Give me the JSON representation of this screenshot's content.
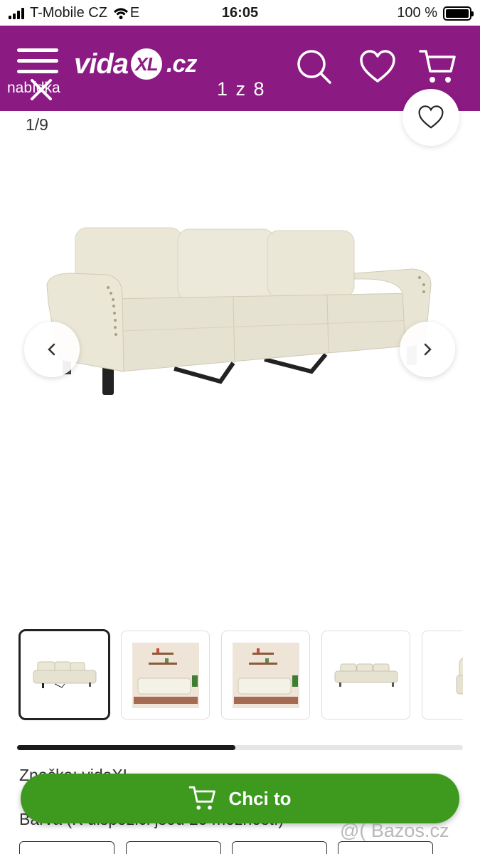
{
  "status_bar": {
    "carrier": "T-Mobile CZ",
    "network": "E",
    "time": "16:05",
    "battery": "100 %",
    "battery_level": 1.0
  },
  "header": {
    "menu_label": "nabídka",
    "logo_prefix": "vida",
    "logo_suffix": ".cz",
    "counter": "1 z 8",
    "icons": [
      "menu-icon",
      "close-icon",
      "search-icon",
      "heart-icon",
      "cart-icon"
    ],
    "background_color": "#8b1a83"
  },
  "gallery": {
    "image_index": "1/9",
    "image_alt": "3-seat cream velvet sofa",
    "thumbnails": [
      {
        "name": "thumb-sofa-front",
        "active": true
      },
      {
        "name": "thumb-sofa-room"
      },
      {
        "name": "thumb-sofa-room-2"
      },
      {
        "name": "thumb-sofa-side"
      },
      {
        "name": "thumb-sofa-arm"
      }
    ],
    "scroll_progress": 0.49
  },
  "details": {
    "brand_line": "Značka: vidaXL",
    "color_line": "Barva (K dispozici jsou 25 možností)"
  },
  "cta": {
    "label": "Chci to",
    "color": "#3d9a1f"
  },
  "watermark": "@( Bazos.cz"
}
